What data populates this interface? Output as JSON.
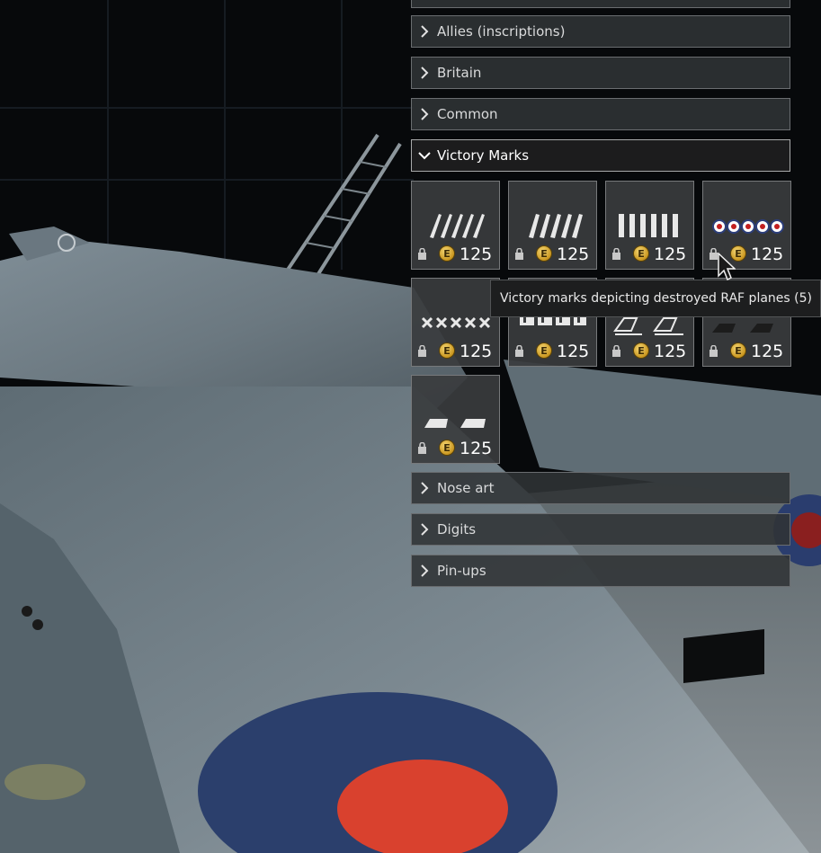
{
  "categories_above": [
    {
      "label": "Allies (inscriptions)"
    },
    {
      "label": "Britain"
    },
    {
      "label": "Common"
    }
  ],
  "open_category": {
    "label": "Victory Marks"
  },
  "decals": [
    {
      "icon": "victory-marks-icon",
      "price": "125",
      "locked": true
    },
    {
      "icon": "victory-marks-icon",
      "price": "125",
      "locked": true
    },
    {
      "icon": "victory-marks-icon",
      "price": "125",
      "locked": true
    },
    {
      "icon": "raf-roundel-marks-icon",
      "price": "125",
      "locked": true
    },
    {
      "icon": "victory-marks-icon",
      "price": "125",
      "locked": true
    },
    {
      "icon": "victory-marks-icon",
      "price": "125",
      "locked": true
    },
    {
      "icon": "victory-marks-icon",
      "price": "125",
      "locked": true
    },
    {
      "icon": "victory-marks-icon",
      "price": "125",
      "locked": true
    },
    {
      "icon": "victory-marks-icon",
      "price": "125",
      "locked": true
    }
  ],
  "categories_below": [
    {
      "label": "Nose art"
    },
    {
      "label": "Digits"
    },
    {
      "label": "Pin-ups"
    }
  ],
  "tooltip": {
    "text": "Victory marks depicting destroyed RAF planes (5)"
  },
  "currency_symbol": "E",
  "colors": {
    "panel_bg": "#303335",
    "coin": "#d4a52c",
    "price_text": "#ffffff"
  }
}
